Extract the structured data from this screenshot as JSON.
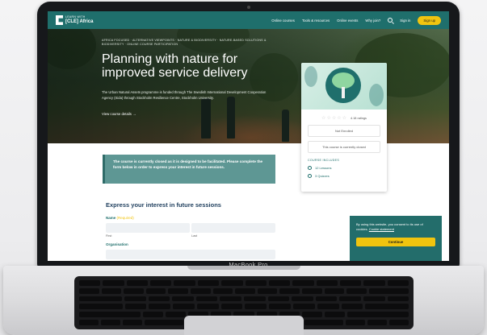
{
  "site": {
    "logo_top": "LEARN WITH",
    "logo_bottom": "[CLE] Africa",
    "nav": [
      "Online courses",
      "Tools & resources",
      "Online events",
      "Why join?",
      "Sign in"
    ],
    "signup_label": "Sign up"
  },
  "hero": {
    "tags": "AFRICA FOCUSED · ALTERNATIVE VIEWPOINTS · NATURE & BIODIVERSITY · NATURE-BASED SOLUTIONS & BIODIVERSITY · ONLINE COURSE PARTICIPATION",
    "title": "Planning with nature for improved service delivery",
    "description": "The Urban Natural Assets programme is funded through The Swedish International Development Cooperation Agency (Sida) through Stockholm Resilience Centre, Stockholm University.",
    "link_label": "View course details →"
  },
  "course_card": {
    "stars": "☆☆☆☆☆",
    "rating": "4.18 ratings",
    "enrolled_label": "Not Enrolled",
    "status": "This course is currently closed",
    "section_title": "COURSE INCLUDES",
    "includes": [
      "12 Lessons",
      "3 Quizzes"
    ]
  },
  "notice": {
    "text": "The course is currently closed as it is designed to be facilitated. Please complete the form below in order to express your interest in future sessions."
  },
  "form": {
    "title": "Express your interest in future sessions",
    "name_label": "Name",
    "required_mark": "(Required)",
    "first_label": "First",
    "last_label": "Last",
    "org_label": "Organisation"
  },
  "cookie": {
    "text": "By using this website, you consent to its use of cookies.",
    "link": "Cookie statement",
    "button": "Continue"
  },
  "device": {
    "model": "MacBook Pro"
  }
}
